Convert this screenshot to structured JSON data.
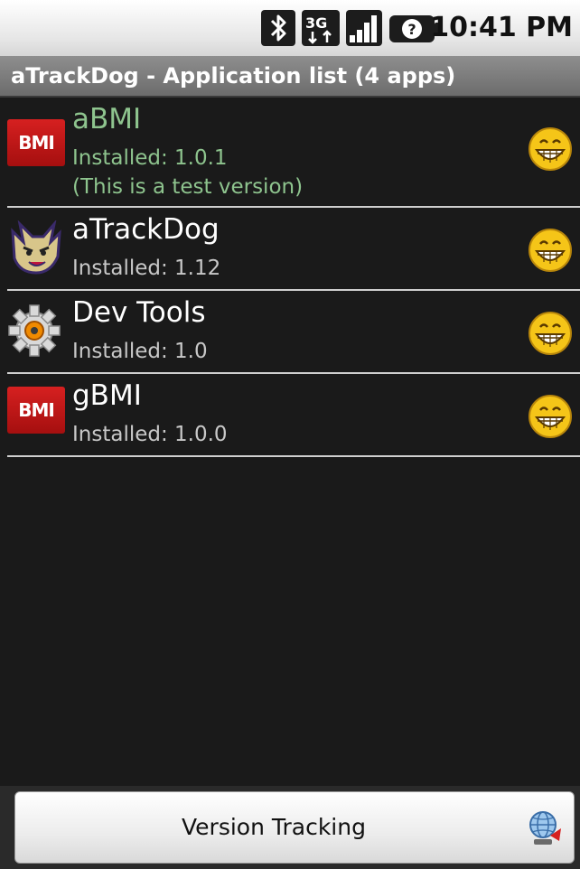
{
  "status_bar": {
    "time": "10:41 PM",
    "icons": [
      "bluetooth-icon",
      "3g-icon",
      "signal-icon",
      "battery-unknown-icon"
    ]
  },
  "title_bar": {
    "title": "aTrackDog - Application list (4 apps)"
  },
  "apps": [
    {
      "name": "aBMI",
      "line1": "Installed: 1.0.1",
      "line2": "(This is a test version)",
      "icon": "bmi-logo-icon",
      "icon_text": "BMI",
      "status_icon": "smiley-icon",
      "text_color": "#8ec48e"
    },
    {
      "name": "aTrackDog",
      "line1": "Installed: 1.12",
      "icon": "dog-icon",
      "status_icon": "smiley-icon"
    },
    {
      "name": "Dev Tools",
      "line1": "Installed: 1.0",
      "icon": "gear-icon",
      "status_icon": "smiley-icon"
    },
    {
      "name": "gBMI",
      "line1": "Installed: 1.0.0",
      "icon": "bmi-logo-icon",
      "icon_text": "BMI",
      "status_icon": "smiley-icon"
    }
  ],
  "bottom_bar": {
    "button_label": "Version Tracking",
    "button_icon": "globe-icon"
  },
  "colors": {
    "background": "#1a1a1a",
    "title_bar": "#7d7d7d",
    "bmi_red": "#c41818",
    "smiley_yellow": "#f5c518"
  }
}
